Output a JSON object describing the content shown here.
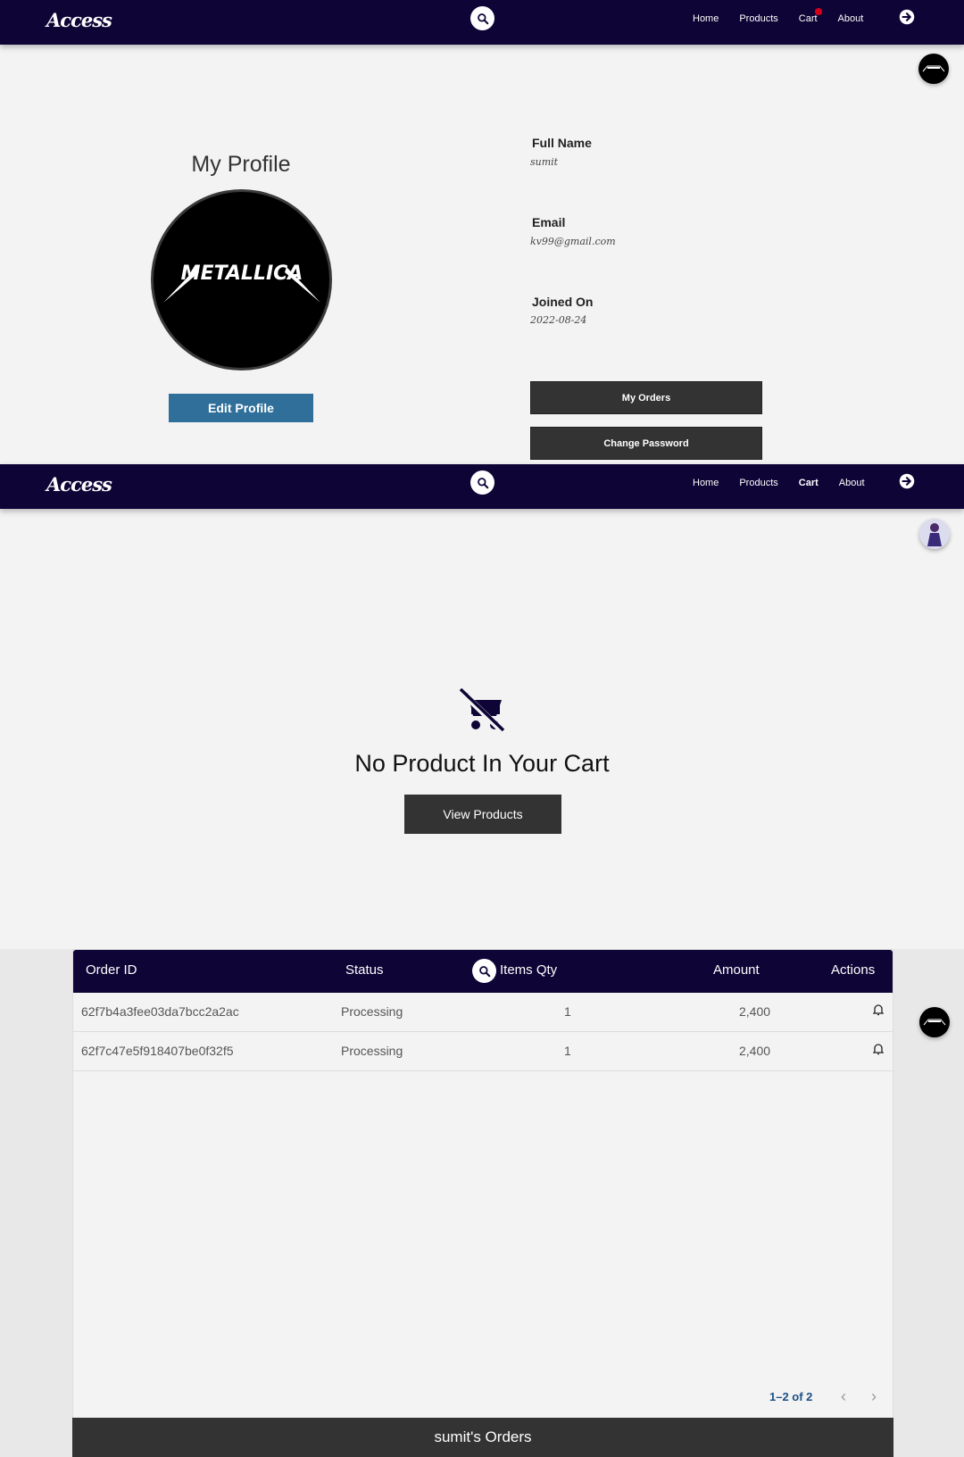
{
  "nav": {
    "logo": "Access",
    "links": [
      "Home",
      "Products",
      "Cart",
      "About"
    ]
  },
  "profile": {
    "title": "My Profile",
    "avatar_text": "METALLICA",
    "edit_label": "Edit Profile",
    "fields": [
      {
        "label": "Full Name",
        "value": "sumit"
      },
      {
        "label": "Email",
        "value": "kv99@gmail.com"
      },
      {
        "label": "Joined On",
        "value": "2022-08-24"
      }
    ],
    "my_orders_label": "My Orders",
    "change_password_label": "Change Password"
  },
  "cart": {
    "empty_message": "No Product In Your Cart",
    "view_products_label": "View Products"
  },
  "orders": {
    "columns": [
      "Order ID",
      "Status",
      "Items Qty",
      "Amount",
      "Actions"
    ],
    "rows": [
      {
        "id": "62f7b4a3fee03da7bcc2a2ac",
        "status": "Processing",
        "qty": "1",
        "amount": "2,400"
      },
      {
        "id": "62f7c47e5f918407be0f32f5",
        "status": "Processing",
        "qty": "1",
        "amount": "2,400"
      }
    ],
    "pagination": "1–2 of 2",
    "footer": "sumit's Orders"
  },
  "colors": {
    "navbar": "#0e0436",
    "edit_button": "#2f6f9a",
    "dark_button": "#333333",
    "cart_dot": "#d8001a"
  }
}
